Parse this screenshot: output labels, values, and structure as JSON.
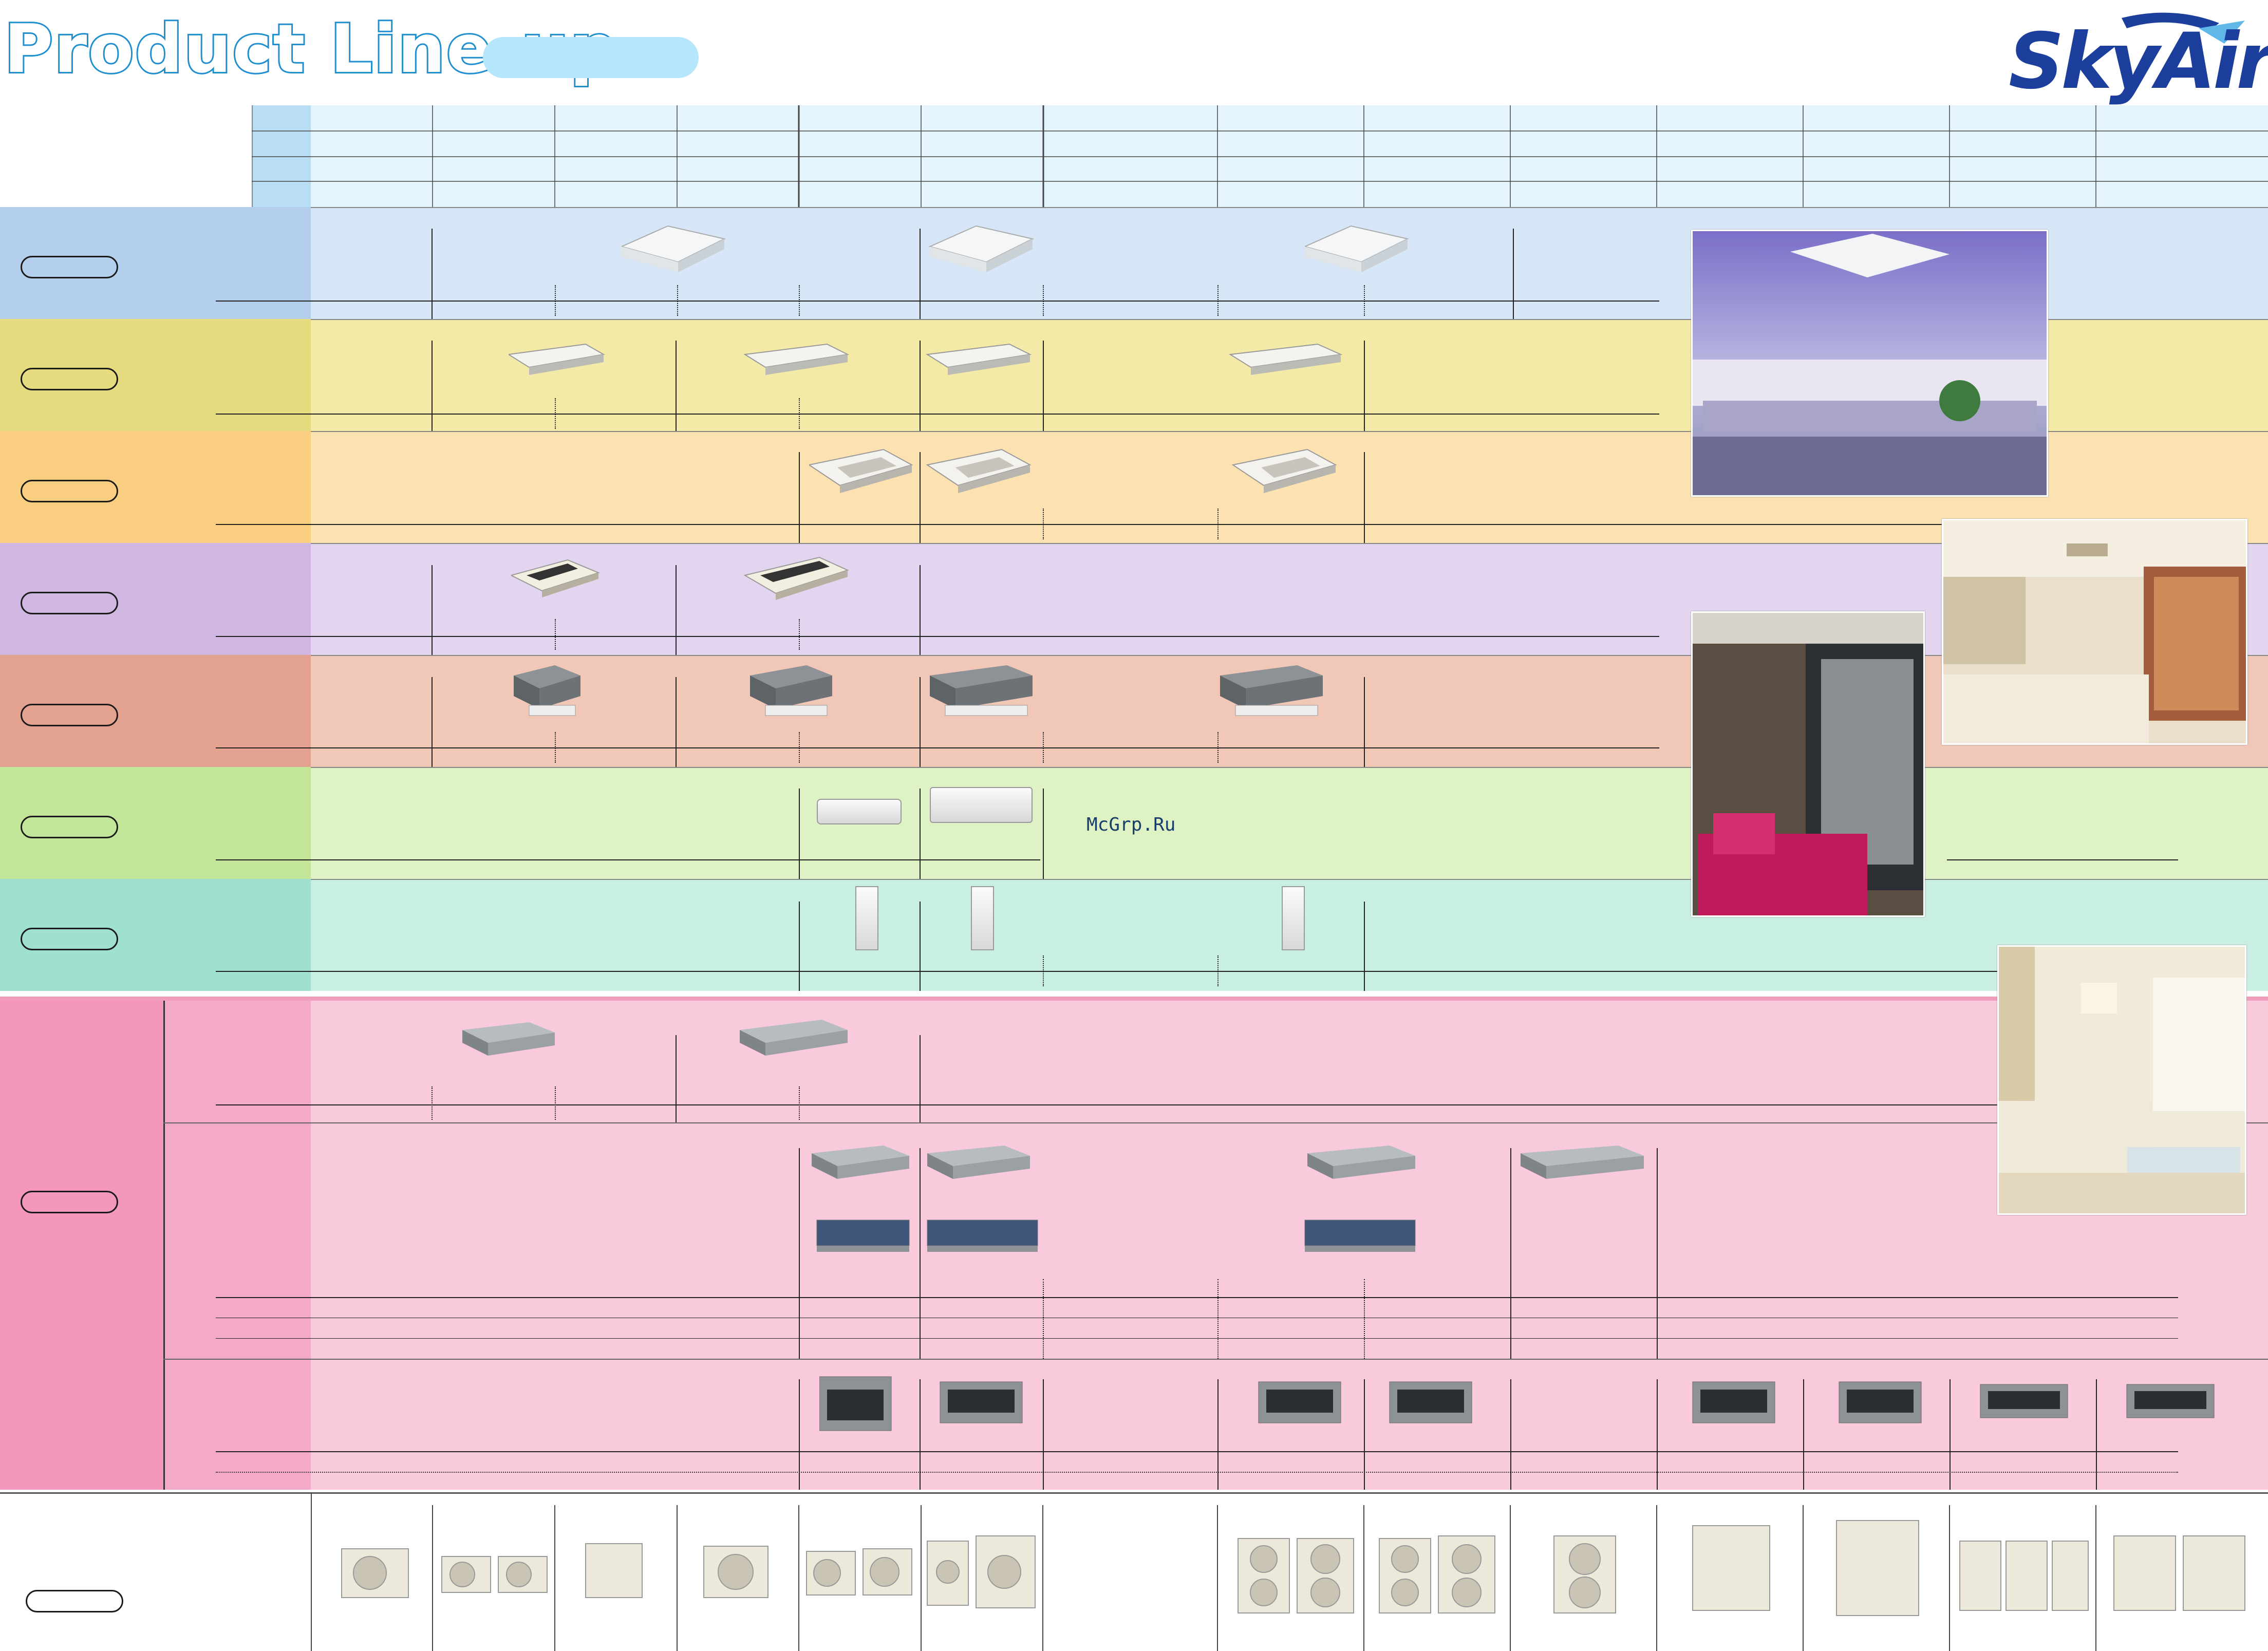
{
  "header": {
    "title": "Product Line-up",
    "logo": "SkyAir"
  },
  "watermark": "McGrp.Ru",
  "colors": {
    "row_cassette_round": "#d7e6f6",
    "row_ceiling_suspended": "#f2eaa6",
    "row_cassette_corner": "#fce2b0",
    "row_ceiling_mounted": "#e3d5ef",
    "row_duct": "#f1c7b8",
    "row_wall": "#def2c3",
    "row_floor": "#c9eee4",
    "row_duct_group": "#f9c9dc",
    "header_cells": "#e4f4fd",
    "logo_blue": "#1c3f9e"
  },
  "icons": [
    "cassette-unit-icon",
    "ceiling-suspended-unit-icon",
    "corner-cassette-unit-icon",
    "ceiling-mounted-unit-icon",
    "concealed-duct-unit-icon",
    "wall-mounted-unit-icon",
    "floor-standing-unit-icon",
    "duct-unit-icon",
    "outdoor-unit-icon"
  ],
  "photos": [
    "office-interior-photo",
    "cafe-interior-photo",
    "lounge-interior-photo",
    "living-room-photo"
  ]
}
